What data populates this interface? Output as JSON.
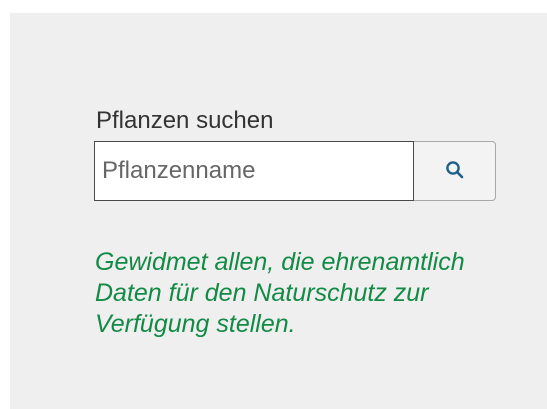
{
  "search": {
    "label": "Pflanzen suchen",
    "placeholder": "Pflanzenname",
    "value": "",
    "button_icon": "search-icon"
  },
  "dedication": {
    "text": "Gewidmet allen, die ehrenamtlich Daten für den Naturschutz zur Verfügung stellen."
  },
  "colors": {
    "panel_background": "#efefef",
    "dedication_text": "#138a45",
    "search_icon": "#1f5f8b"
  }
}
